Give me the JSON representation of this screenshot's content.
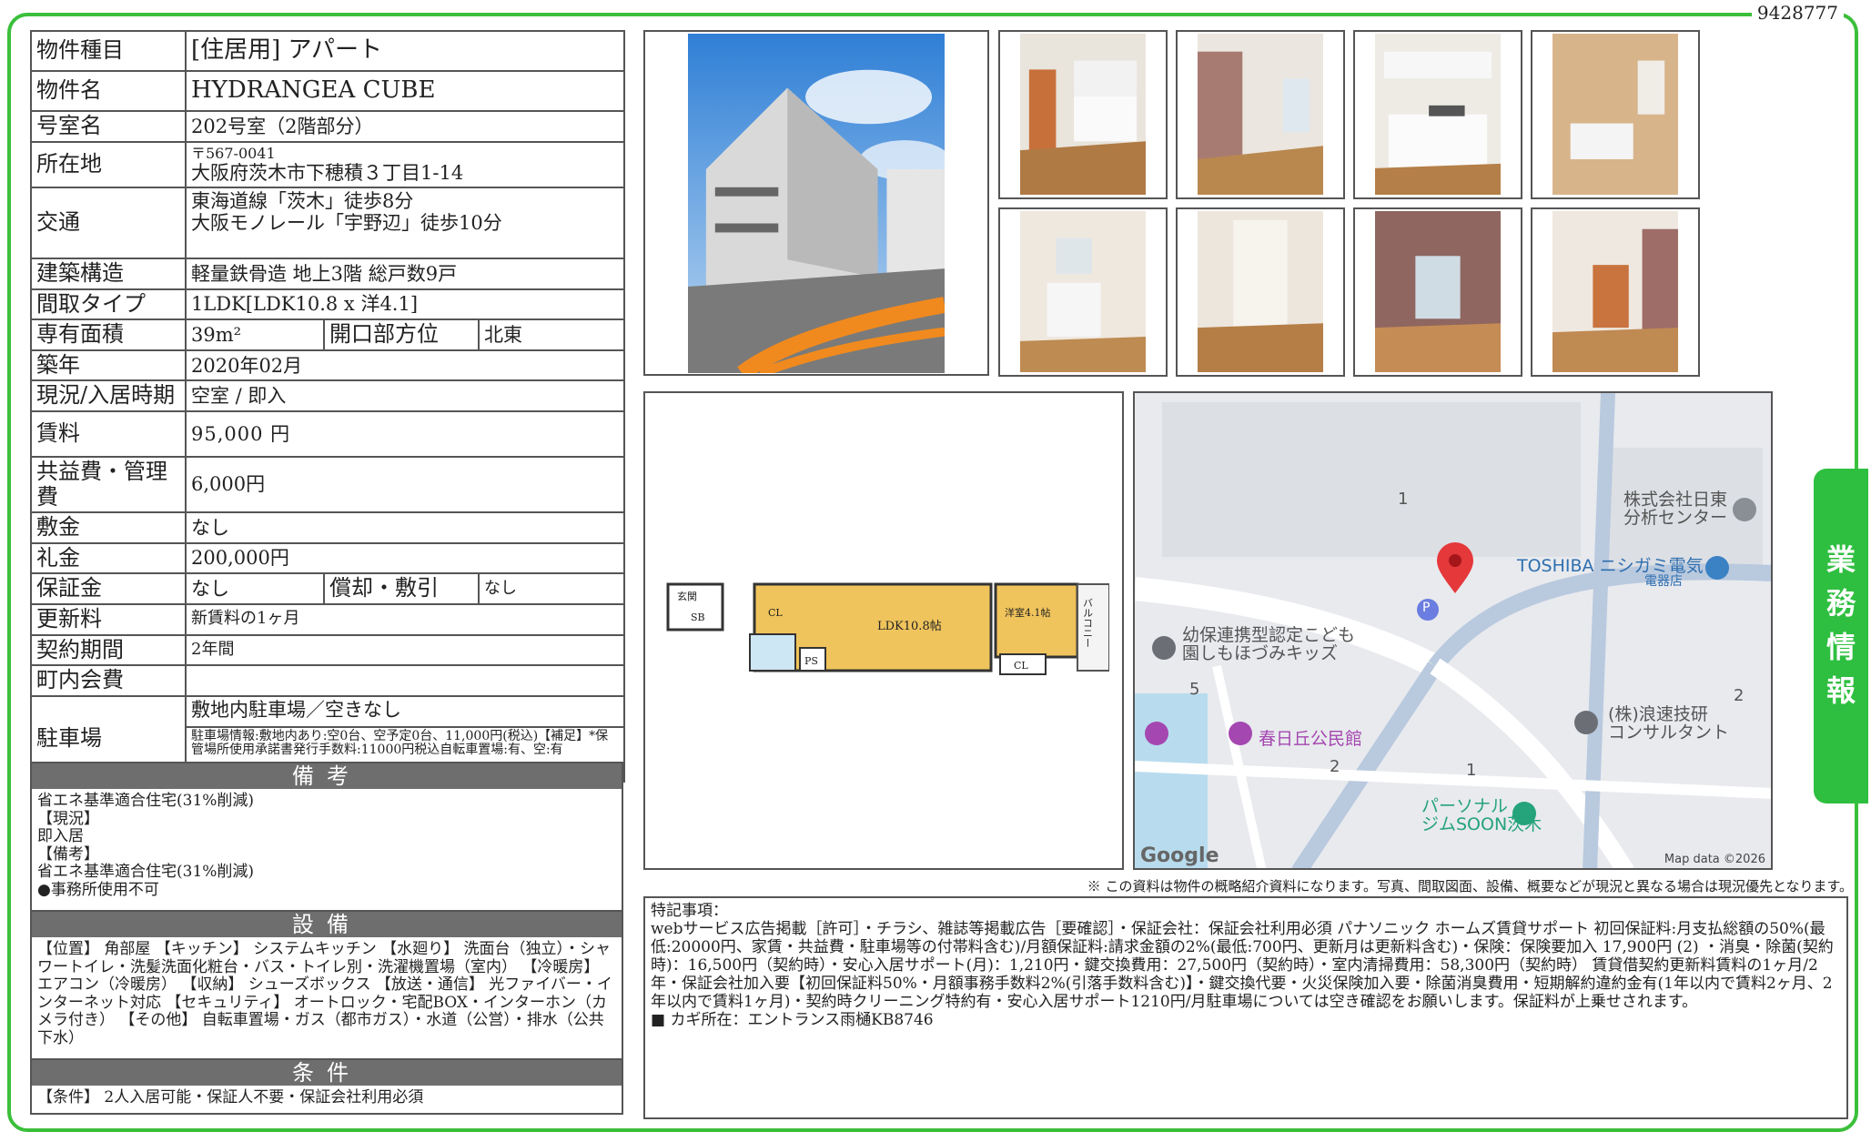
{
  "doc_id": "9428777",
  "spec": {
    "type_label": "物件種目",
    "type_value": "[住居用] アパート",
    "name_label": "物件名",
    "name_value": "HYDRANGEA CUBE",
    "room_label": "号室名",
    "room_value": "202号室（2階部分）",
    "address_label": "所在地",
    "postal": "〒567-0041",
    "address_value": "大阪府茨木市下穂積３丁目1-14",
    "access_label": "交通",
    "access_line1": "東海道線「茨木」徒歩8分",
    "access_line2": "大阪モノレール「宇野辺」徒歩10分",
    "structure_label": "建築構造",
    "structure_value": "軽量鉄骨造 地上3階 総戸数9戸",
    "layout_label": "間取タイプ",
    "layout_value": "1LDK[LDK10.8 x 洋4.1]",
    "area_label": "専有面積",
    "area_value": "39m²",
    "direction_label": "開口部方位",
    "direction_value": "北東",
    "built_label": "築年",
    "built_value": "2020年02月",
    "status_label": "現況/入居時期",
    "status_value": "空室 / 即入",
    "rent_label": "賃料",
    "rent_value": "95,000 円",
    "fee_label": "共益費・管理費",
    "fee_value": "6,000円",
    "deposit_label": "敷金",
    "deposit_value": "なし",
    "keymoney_label": "礼金",
    "keymoney_value": "200,000円",
    "guarantee_label": "保証金",
    "guarantee_value": "なし",
    "amort_label": "償却・敷引",
    "amort_value": "なし",
    "renewal_label": "更新料",
    "renewal_value": "新賃料の1ヶ月",
    "contract_label": "契約期間",
    "contract_value": "2年間",
    "assoc_label": "町内会費",
    "assoc_value": "",
    "parking_label": "駐車場",
    "parking_value": "敷地内駐車場／空きなし",
    "parking_detail": "駐車場情報:敷地内あり:空0台、空予定0台、11,000円(税込)【補足】*保管場所使用承諾書発行手数料:11000円税込自転車置場:有、空:有"
  },
  "remarks": {
    "title": "備考",
    "body": "省エネ基準適合住宅(31%削減)\n【現況】\n即入居\n【備考】\n省エネ基準適合住宅(31%削減)\n●事務所使用不可"
  },
  "equipment": {
    "title": "設備",
    "body": "【位置】 角部屋 【キッチン】 システムキッチン 【水廻り】 洗面台（独立）・シャワートイレ・洗髪洗面化粧台・バス・トイレ別・洗濯機置場（室内） 【冷暖房】 エアコン（冷暖房） 【収納】 シューズボックス 【放送・通信】 光ファイバー・インターネット対応 【セキュリティ】 オートロック・宅配BOX・インターホン（カメラ付き） 【その他】 自転車置場・ガス（都市ガス）・水道（公営）・排水（公共下水）"
  },
  "conditions": {
    "title": "条件",
    "body": "【条件】 2人入居可能・保証人不要・保証会社利用必須"
  },
  "floorplan": {
    "entry": "玄関",
    "sb": "SB",
    "cl1": "CL",
    "ldk": "LDK10.8帖",
    "ps": "PS",
    "yo": "洋室4.1帖",
    "cl2": "CL",
    "balcony": "バルコニー"
  },
  "map": {
    "labels": [
      "1",
      "5",
      "2",
      "1",
      "2"
    ],
    "poi_nitto": "株式会社日東\n分析センター",
    "poi_toshiba": "TOSHIBA ニシガミ電気",
    "poi_toshiba_sub": "電器店",
    "poi_kids": "幼保連携型認定こども\n園しもほづみキッズ",
    "poi_kasuga": "春日丘公民館",
    "poi_naniwa": "(株)浪速技研\nコンサルタント",
    "poi_gym": "パーソナル\nジムSOON茨木",
    "google": "Google",
    "mapdata": "Map data ©2026",
    "pin_p": "P"
  },
  "note": "※ この資料は物件の概略紹介資料になります。写真、間取図面、設備、概要などが現況と異なる場合は現況優先となります。",
  "tokki": {
    "title": "特記事項：",
    "body": "webサービス広告掲載［許可］・チラシ、雑誌等掲載広告［要確認］・保証会社：保証会社利用必須 パナソニック ホームズ賃貸サポート 初回保証料:月支払総額の50%(最低:20000円、家賃・共益費・駐車場等の付帯料含む)/月額保証料:請求金額の2%(最低:700円、更新月は更新料含む)・保険：保険要加入 17,900円 (2) ・消臭・除菌(契約時)：16,500円（契約時）・安心入居サポート(月)：1,210円・鍵交換費用：27,500円（契約時）・室内清掃費用：58,300円（契約時） 賃貸借契約更新料賃料の1ヶ月/2年・保証会社加入要【初回保証料50%・月額事務手数料2%(引落手数料含む)】・鍵交換代要・火災保険加入要・除菌消臭費用・短期解約違約金有(1年以内で賃料2ヶ月、2年以内で賃料1ヶ月)・契約時クリーニング特約有・安心入居サポート1210円/月駐車場については空き確認をお願いします。保証料が上乗せされます。",
    "key": "■ カギ所在：エントランス雨樋KB8746"
  },
  "tab": [
    "業",
    "務",
    "情",
    "報"
  ]
}
